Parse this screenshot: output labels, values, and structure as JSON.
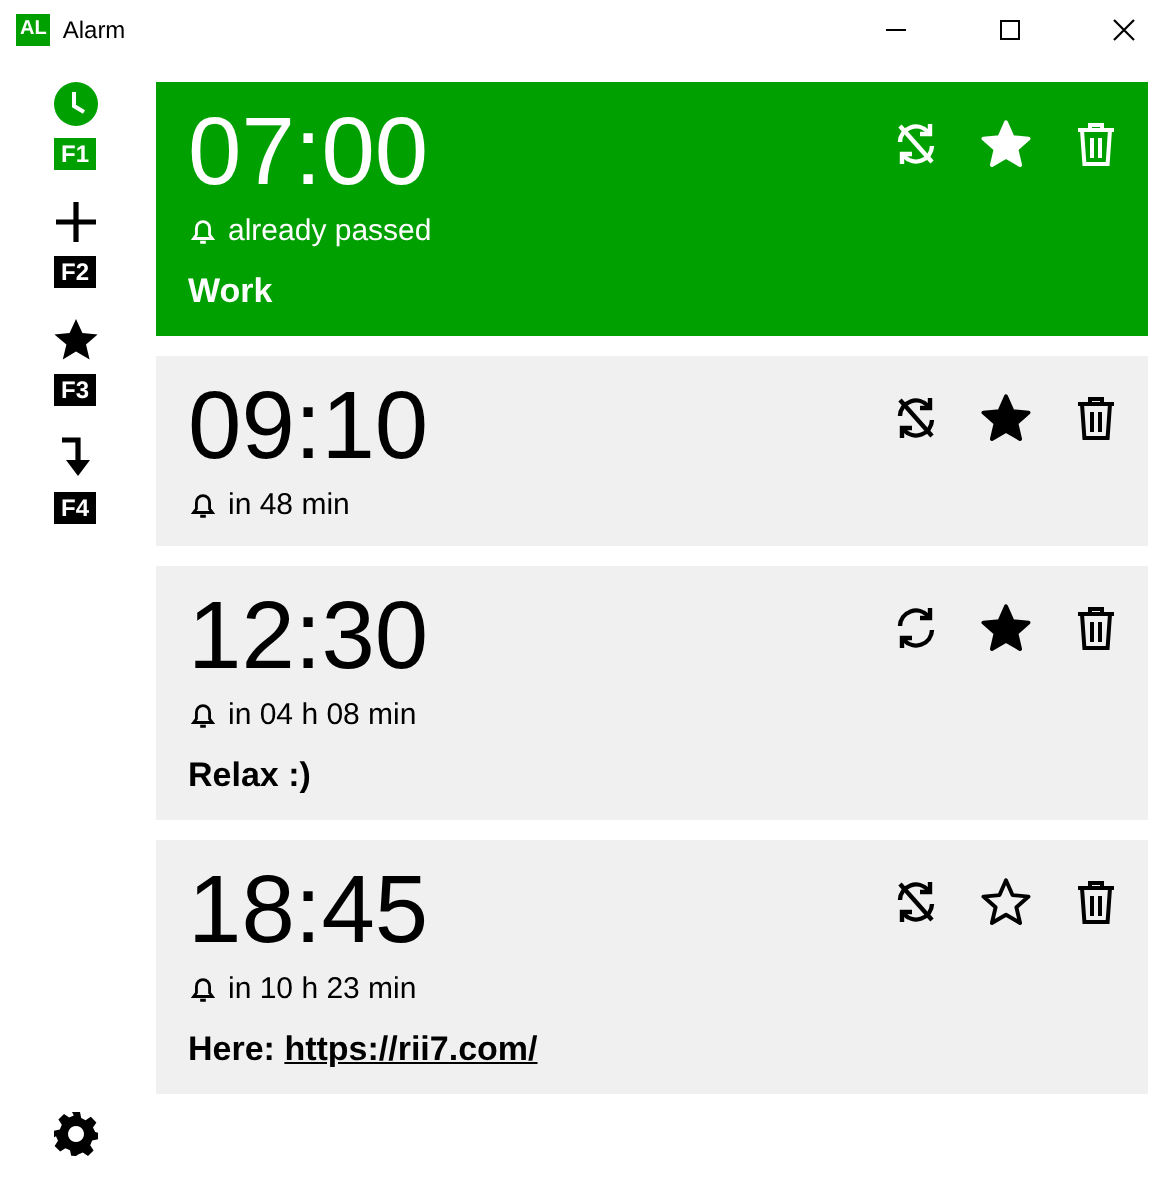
{
  "window": {
    "logo": "AL",
    "title": "Alarm"
  },
  "sidebar": {
    "items": [
      {
        "kind": "clock",
        "key": "F1",
        "selected": true
      },
      {
        "kind": "add",
        "key": "F2",
        "selected": false
      },
      {
        "kind": "star",
        "key": "F3",
        "selected": false
      },
      {
        "kind": "jump",
        "key": "F4",
        "selected": false
      }
    ]
  },
  "alarms": [
    {
      "time": "07:00",
      "status": "already passed",
      "note": "Work",
      "highlighted": true,
      "repeat": false,
      "favorite": true
    },
    {
      "time": "09:10",
      "status": "in 48 min",
      "highlighted": false,
      "repeat": false,
      "favorite": true
    },
    {
      "time": "12:30",
      "status": "in 04 h 08 min",
      "note": "Relax :)",
      "highlighted": false,
      "repeat": true,
      "favorite": true
    },
    {
      "time": "18:45",
      "status": "in 10 h 23 min",
      "note": "Here: ",
      "link": "https://rii7.com/",
      "highlighted": false,
      "repeat": false,
      "favorite": false
    }
  ]
}
